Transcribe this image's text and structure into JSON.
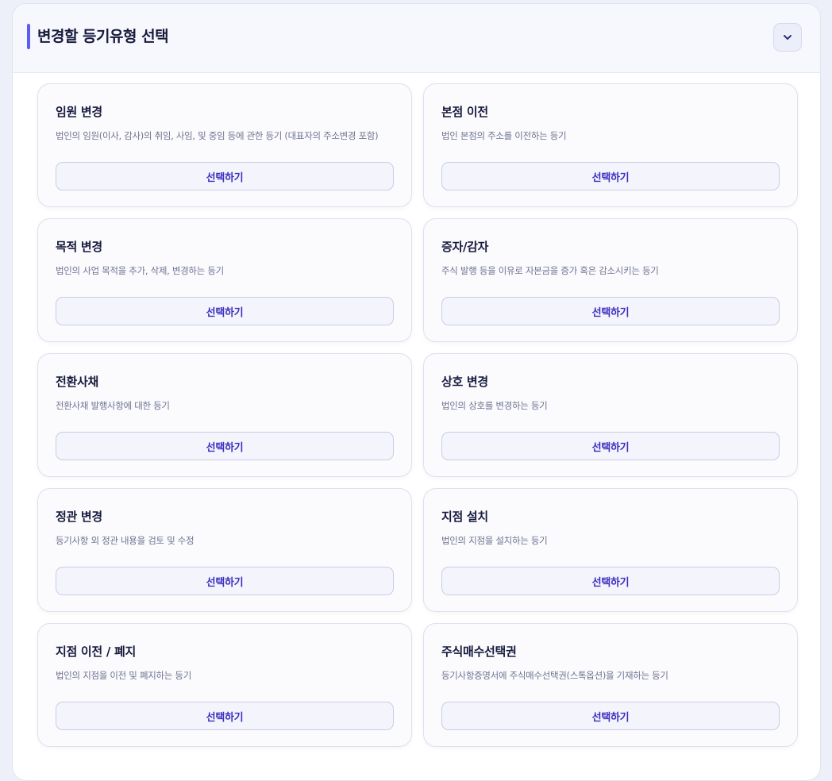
{
  "section": {
    "title": "변경할 등기유형 선택",
    "collapse_icon": "chevron-down-icon",
    "accent_color": "#5b5ef0"
  },
  "registration_types": [
    {
      "title": "임원 변경",
      "description": "법인의 임원(이사, 감사)의 취임, 사임, 및 중임 등에 관한 등기 (대표자의 주소변경 포함)",
      "button_label": "선택하기"
    },
    {
      "title": "본점 이전",
      "description": "법인 본점의 주소를 이전하는 등기",
      "button_label": "선택하기"
    },
    {
      "title": "목적 변경",
      "description": "법인의 사업 목적을 추가, 삭제, 변경하는 등기",
      "button_label": "선택하기"
    },
    {
      "title": "증자/감자",
      "description": "주식 발행 등을 이유로 자본금을 증가 혹은 감소시키는 등기",
      "button_label": "선택하기"
    },
    {
      "title": "전환사채",
      "description": "전환사채 발행사항에 대한 등기",
      "button_label": "선택하기"
    },
    {
      "title": "상호 변경",
      "description": "법인의 상호를 변경하는 등기",
      "button_label": "선택하기"
    },
    {
      "title": "정관 변경",
      "description": "등기사항 외 정관 내용을 검토 및 수정",
      "button_label": "선택하기"
    },
    {
      "title": "지점 설치",
      "description": "법인의 지점을 설치하는 등기",
      "button_label": "선택하기"
    },
    {
      "title": "지점 이전 / 폐지",
      "description": "법인의 지점을 이전 및 폐지하는 등기",
      "button_label": "선택하기"
    },
    {
      "title": "주식매수선택권",
      "description": "등기사항증명서에 주식매수선택권(스톡옵션)을 기재하는 등기",
      "button_label": "선택하기"
    }
  ]
}
